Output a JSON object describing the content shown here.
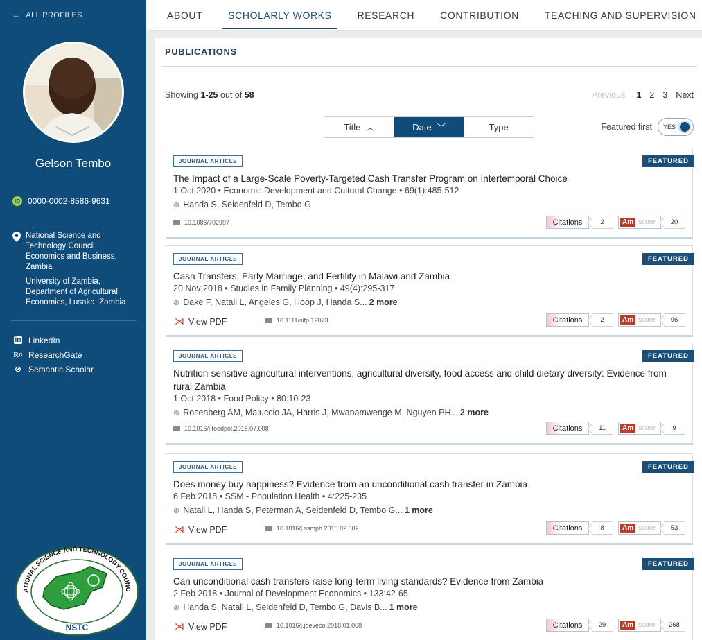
{
  "sidebar": {
    "back_label": "ALL PROFILES",
    "name": "Gelson Tembo",
    "orcid": "0000-0002-8586-9631",
    "affiliations": [
      "National Science and Technology Council, Economics and Business, Zambia",
      "University of Zambia, Department of Agricultural Economics, Lusaka, Zambia"
    ],
    "links": [
      {
        "label": "LinkedIn",
        "icon": "linkedin-icon"
      },
      {
        "label": "ResearchGate",
        "icon": "researchgate-icon"
      },
      {
        "label": "Semantic Scholar",
        "icon": "semantic-scholar-icon"
      }
    ],
    "logo_text": "NATIONAL SCIENCE AND TECHNOLOGY COUNCIL",
    "logo_abbrev": "NSTC"
  },
  "tabs": [
    "ABOUT",
    "SCHOLARLY WORKS",
    "RESEARCH",
    "CONTRIBUTION",
    "TEACHING AND SUPERVISION"
  ],
  "active_tab": "SCHOLARLY WORKS",
  "publications": {
    "section_title": "PUBLICATIONS",
    "showing_prefix": "Showing ",
    "showing_range": "1-25",
    "showing_mid": " out of ",
    "showing_total": "58",
    "pager": {
      "prev": "Previous",
      "pages": [
        "1",
        "2",
        "3"
      ],
      "next": "Next",
      "current": "1"
    },
    "sort": {
      "title": "Title",
      "date": "Date",
      "type": "Type",
      "active": "Date"
    },
    "featured_first_label": "Featured first",
    "toggle_label": "YES",
    "citations_label": "Citations",
    "altmetric_label": "score",
    "altmetric_abbrev": "Am",
    "view_pdf_label": "View PDF",
    "items": [
      {
        "type": "JOURNAL ARTICLE",
        "featured": "FEATURED",
        "title": "The Impact of a Large-Scale Poverty-Targeted Cash Transfer Program on Intertemporal Choice",
        "meta": "1 Oct 2020  •  Economic Development and Cultural Change  •  69(1):485-512",
        "authors": "Handa S, Seidenfeld D, Tembo G",
        "more": "",
        "doi": "10.1086/702997",
        "pdf": false,
        "citations": "2",
        "altmetric": "20"
      },
      {
        "type": "JOURNAL ARTICLE",
        "featured": "FEATURED",
        "title": "Cash Transfers, Early Marriage, and Fertility in Malawi and Zambia",
        "meta": "20 Nov 2018  •  Studies in Family Planning  •  49(4):295-317",
        "authors": "Dake F, Natali L, Angeles G, Hoop J, Handa S...",
        "more": "2 more",
        "doi": "10.1111/sifp.12073",
        "pdf": true,
        "citations": "2",
        "altmetric": "96"
      },
      {
        "type": "JOURNAL ARTICLE",
        "featured": "FEATURED",
        "title": "Nutrition-sensitive agricultural interventions, agricultural diversity, food access and child dietary diversity: Evidence from rural Zambia",
        "meta": "1 Oct 2018  •  Food Policy  •  80:10-23",
        "authors": "Rosenberg AM, Maluccio JA, Harris J, Mwanamwenge M, Nguyen PH...",
        "more": "2 more",
        "doi": "10.1016/j.foodpol.2018.07.008",
        "pdf": false,
        "citations": "11",
        "altmetric": "9"
      },
      {
        "type": "JOURNAL ARTICLE",
        "featured": "FEATURED",
        "title": "Does money buy happiness? Evidence from an unconditional cash transfer in Zambia",
        "meta": "6 Feb 2018  •  SSM - Population Health  •  4:225-235",
        "authors": "Natali L, Handa S, Peterman A, Seidenfeld D, Tembo G...",
        "more": "1 more",
        "doi": "10.1016/j.ssmph.2018.02.002",
        "pdf": true,
        "citations": "8",
        "altmetric": "53"
      },
      {
        "type": "JOURNAL ARTICLE",
        "featured": "FEATURED",
        "title": "Can unconditional cash transfers raise long-term living standards? Evidence from Zambia",
        "meta": "2 Feb 2018  •  Journal of Development Economics  •  133:42-65",
        "authors": "Handa S, Natali L, Seidenfeld D, Tembo G, Davis B...",
        "more": "1 more",
        "doi": "10.1016/j.jdeveco.2018.01.008",
        "pdf": true,
        "citations": "29",
        "altmetric": "268"
      }
    ]
  },
  "colors": {
    "sidebar": "#0f4c7a",
    "accent": "#1b4f78",
    "pdf": "#d0362b",
    "orcid": "#a6ce39"
  }
}
